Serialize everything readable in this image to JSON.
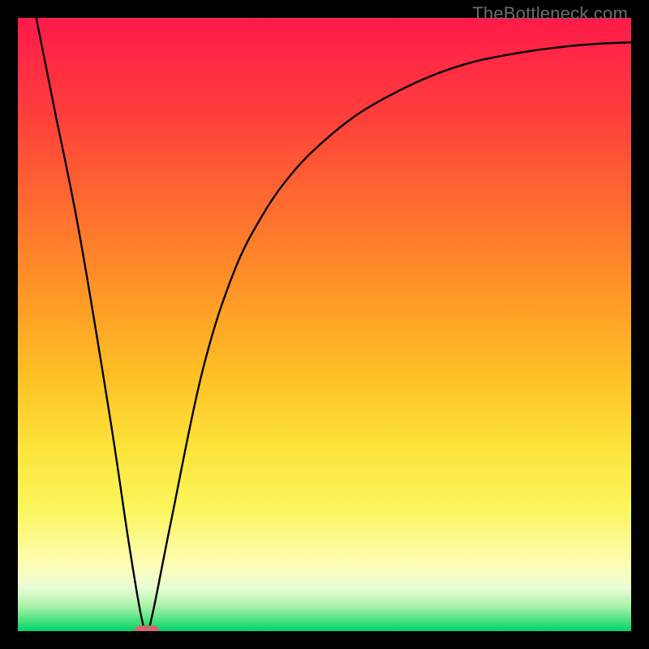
{
  "watermark": "TheBottleneck.com",
  "chart_data": {
    "type": "line",
    "title": "",
    "xlabel": "",
    "ylabel": "",
    "xlim": [
      0,
      100
    ],
    "ylim": [
      0,
      100
    ],
    "grid": false,
    "legend": false,
    "series": [
      {
        "name": "bottleneck-curve",
        "x": [
          3,
          6,
          10,
          15,
          18,
          20,
          21,
          22,
          25,
          30,
          35,
          40,
          45,
          50,
          55,
          60,
          65,
          70,
          75,
          80,
          85,
          90,
          95,
          100
        ],
        "y": [
          100,
          85,
          65,
          35,
          15,
          3,
          0,
          3,
          18,
          42,
          58,
          68,
          75,
          80,
          84,
          87,
          89.5,
          91.5,
          93,
          94,
          94.8,
          95.4,
          95.8,
          96
        ]
      }
    ],
    "annotations": [
      {
        "name": "optimal-marker",
        "x": 21,
        "y": 0,
        "color": "#cf6a6f"
      }
    ]
  }
}
